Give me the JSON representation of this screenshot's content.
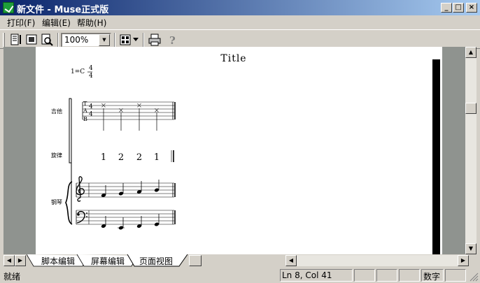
{
  "window": {
    "title": "新文件 - Muse正式版",
    "minimize": "_",
    "maximize": "□",
    "close": "×"
  },
  "menu": {
    "items": [
      "打印(F)",
      "编辑(E)",
      "帮助(H)"
    ]
  },
  "toolbar": {
    "zoom": "100%",
    "icons": [
      "format-icon",
      "frame-icon",
      "preview-icon",
      "grid-icon",
      "print-icon",
      "help-icon"
    ]
  },
  "score": {
    "title": "Title",
    "key": "1=C",
    "time_numerator": "4",
    "time_denominator": "4",
    "parts": [
      "吉他",
      "旋律",
      "钢琴"
    ],
    "tab_clef": [
      "T",
      "A",
      "B"
    ],
    "tab_time": [
      "4",
      "4"
    ],
    "tab_mark": "×",
    "jianpu_notes": [
      "1",
      "2",
      "2",
      "1"
    ]
  },
  "tabs": [
    {
      "label": "脚本编辑",
      "active": false
    },
    {
      "label": "屏幕编辑",
      "active": false
    },
    {
      "label": "页面视图",
      "active": true
    }
  ],
  "status": {
    "ready": "就绪",
    "position": "Ln 8, Col 41",
    "mode": "数字"
  }
}
